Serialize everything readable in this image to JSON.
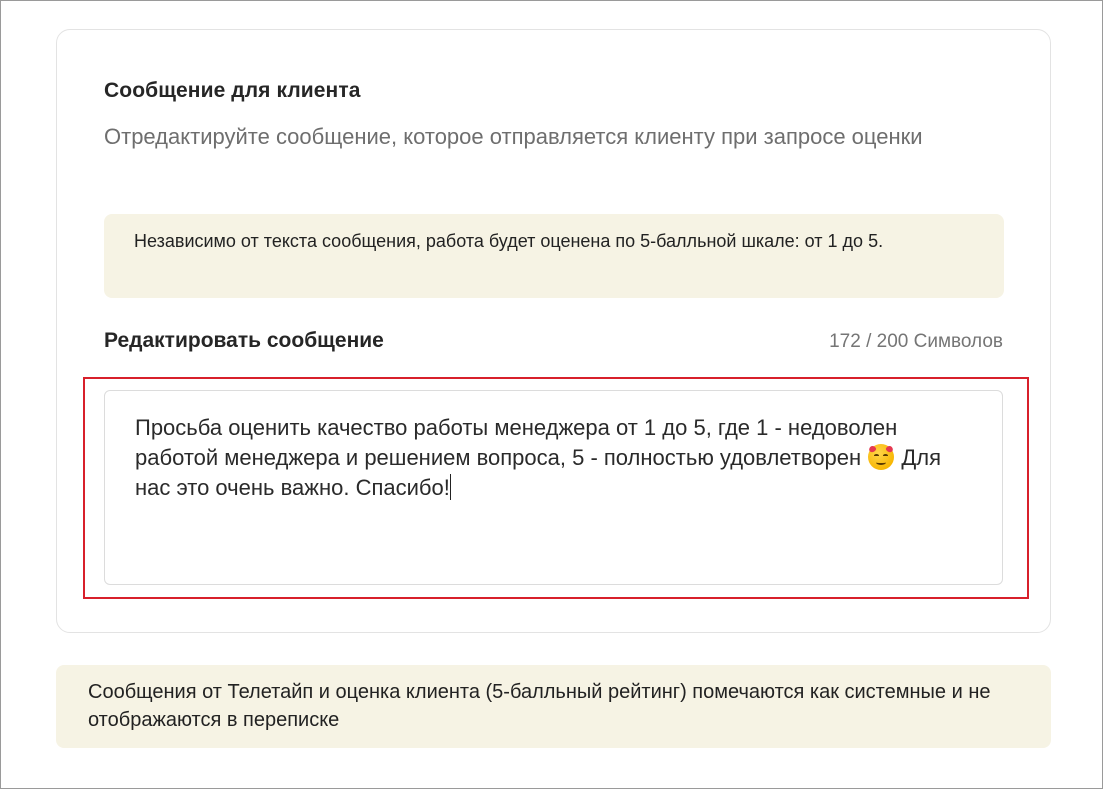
{
  "card": {
    "title": "Сообщение для клиента",
    "description": "Отредактируйте сообщение, которое отправляется клиенту при запросе оценки",
    "info_note": "Независимо от текста сообщения, работа будет оценена по 5-балльной шкале: от 1 до 5."
  },
  "editor": {
    "label": "Редактировать сообщение",
    "char_count": "172 / 200 Символов",
    "message_part1": "Просьба оценить качество работы менеджера от 1 до 5, где 1 - недоволен работой менеджера и решением вопроса, 5 - полностью удовлетворен ",
    "emoji_icon": "smiling-face-with-hearts-icon",
    "message_part2": " Для нас это очень важно. Спасибо!"
  },
  "footer_note": "Сообщения от Телетайп и оценка клиента (5-балльный рейтинг) помечаются как системные и не отображаются в переписке",
  "colors": {
    "note_background": "#f6f3e4",
    "highlight_border": "#d8202b"
  }
}
